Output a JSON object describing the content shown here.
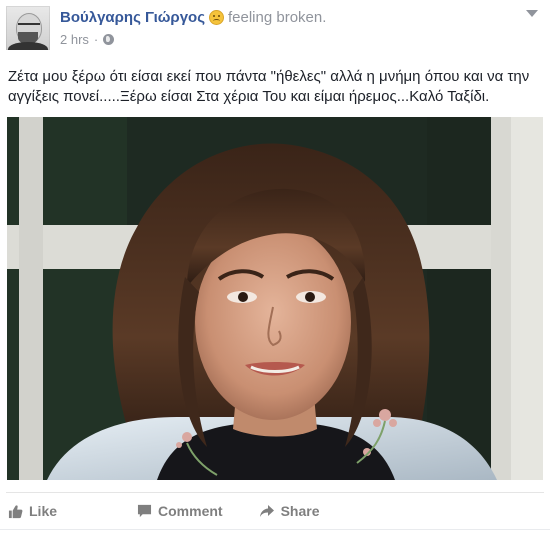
{
  "post": {
    "author": "Βούλγαρης Γιώργος",
    "feeling": "feeling broken.",
    "feeling_icon": "sad-face-emoji-icon",
    "timestamp": "2 hrs",
    "separator": "·",
    "privacy_icon": "globe-icon",
    "text": "Ζέτα μου ξέρω ότι είσαι εκεί που πάντα \"ήθελες\" αλλά η μνήμη όπου και να την αγγίξεις πονεί.....Ξέρω είσαι Στα χέρια Του και είμαι ήρεμος...Καλό Ταξίδι.",
    "photo_subject": "portrait photo of a smiling woman with shoulder-length brown hair"
  },
  "actions": {
    "like": "Like",
    "comment": "Comment",
    "share": "Share"
  },
  "colors": {
    "author": "#365899",
    "meta": "#90949c",
    "text": "#1d2129",
    "action": "#7f7f7f"
  }
}
